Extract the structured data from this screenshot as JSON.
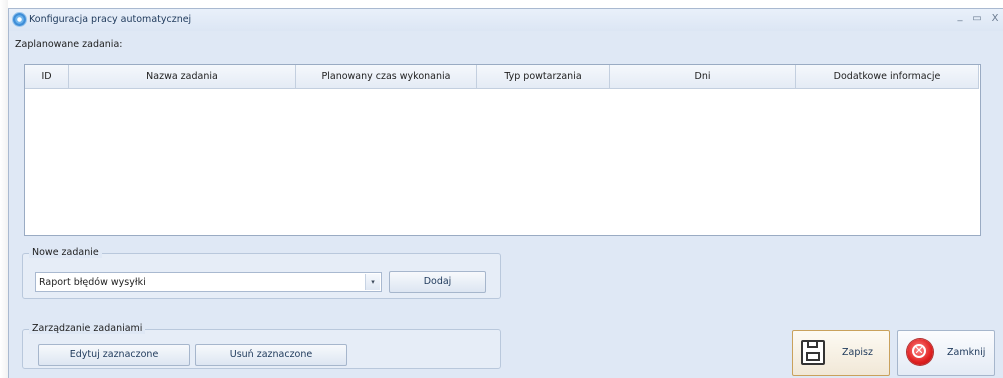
{
  "window": {
    "title": "Konfiguracja pracy automatycznej",
    "minimize_glyph": "_",
    "maximize_glyph": "▭",
    "close_glyph": "X"
  },
  "scheduled": {
    "label": "Zaplanowane zadania:",
    "columns": [
      "ID",
      "Nazwa zadania",
      "Planowany czas wykonania",
      "Typ powtarzania",
      "Dni",
      "Dodatkowe informacje"
    ],
    "rows": []
  },
  "new_task": {
    "group_title": "Nowe zadanie",
    "selected": "Raport błędów wysyłki",
    "dropdown_glyph": "▾",
    "add_label": "Dodaj"
  },
  "manage": {
    "group_title": "Zarządzanie zadaniami",
    "edit_label": "Edytuj zaznaczone",
    "delete_label": "Usuń zaznaczone"
  },
  "actions": {
    "save_label": "Zapisz",
    "close_label": "Zamknij",
    "close_glyph": "✕"
  },
  "icons": {
    "app": "gear-icon",
    "save": "floppy-disk-icon",
    "close": "close-circle-icon"
  }
}
